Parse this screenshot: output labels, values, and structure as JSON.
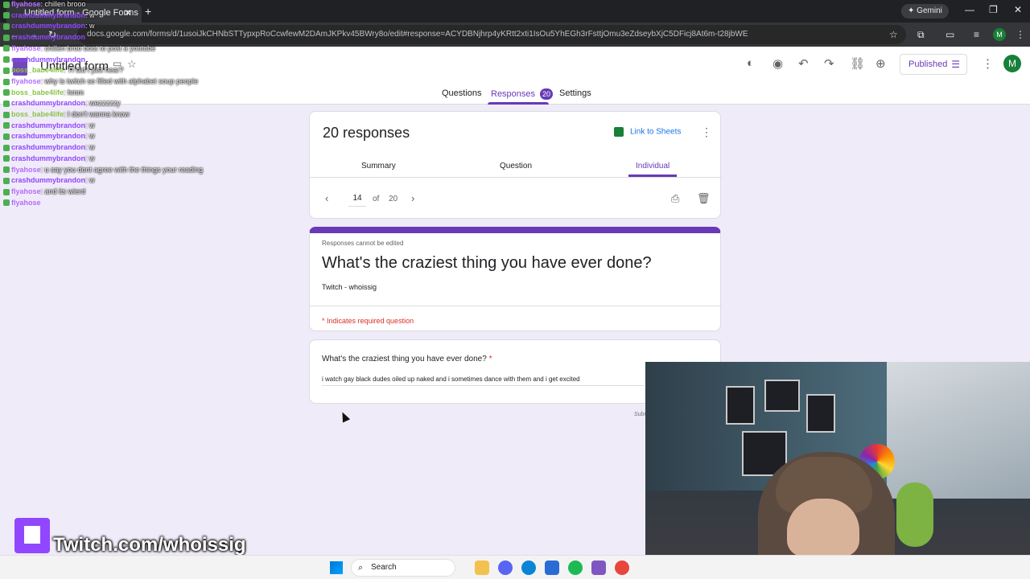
{
  "browser": {
    "tab_title": "Untitled form - Google Forms",
    "url": "docs.google.com/forms/d/1usoiJkCHNbSTTypxpRoCcwfewM2DAmJKPkv45BWry8o/edit#response=ACYDBNjhrp4yKRtt2xti1IsOu5YhEGh3rFsttjOmu3eZdseybXjC5DFicj8At6m-t28jbWE",
    "gemini_label": "Gemini",
    "profile_initial": "M"
  },
  "form_header": {
    "title": "Untitled form",
    "published_label": "Published",
    "avatar_initial": "M",
    "tabs": [
      {
        "label": "Questions"
      },
      {
        "label": "Responses",
        "badge": "20"
      },
      {
        "label": "Settings"
      }
    ]
  },
  "responses_card": {
    "heading": "20 responses",
    "link_to_sheets": "Link to Sheets",
    "subtabs": [
      "Summary",
      "Question",
      "Individual"
    ],
    "pager": {
      "current": "14",
      "of_label": "of",
      "total": "20"
    }
  },
  "response_view": {
    "cannot_edit_note": "Responses cannot be edited",
    "form_title": "What's the craziest thing you have ever done?",
    "form_description": "Twitch - whoissig",
    "required_note": "* Indicates required question",
    "question": "What's the craziest thing you have ever done?",
    "required_star": "*",
    "answer": "i watch gay black dudes oiled up naked and i sometimes dance with them and i get excited",
    "submitted_label": "Subm"
  },
  "chat": [
    {
      "user": "flyahose",
      "color": "#b36bff",
      "msg": "chillen brooo"
    },
    {
      "user": "crashdummybrandon",
      "color": "#9146ff",
      "msg": "w"
    },
    {
      "user": "crashdummybrandon",
      "color": "#9146ff",
      "msg": "w"
    },
    {
      "user": "crashdummybrandon",
      "color": "#9146ff",
      "msg": ""
    },
    {
      "user": "flyahose",
      "color": "#b36bff",
      "msg": "chillen broo bout to post a youtube"
    },
    {
      "user": "crashdummybrandon",
      "color": "#9146ff",
      "msg": ""
    },
    {
      "user": "boss_babe4life",
      "color": "#8bc34a",
      "msg": "Tf did I just hear?"
    },
    {
      "user": "flyahose",
      "color": "#b36bff",
      "msg": "why is twitch so filled with alphabet soup people"
    },
    {
      "user": "boss_babe4life",
      "color": "#8bc34a",
      "msg": "hmm"
    },
    {
      "user": "crashdummybrandon",
      "color": "#9146ff",
      "msg": "wezzzzzy"
    },
    {
      "user": "boss_babe4life",
      "color": "#8bc34a",
      "msg": "I don't wanna know"
    },
    {
      "user": "crashdummybrandon",
      "color": "#9146ff",
      "msg": "w"
    },
    {
      "user": "crashdummybrandon",
      "color": "#9146ff",
      "msg": "w"
    },
    {
      "user": "crashdummybrandon",
      "color": "#9146ff",
      "msg": "w"
    },
    {
      "user": "crashdummybrandon",
      "color": "#9146ff",
      "msg": "w"
    },
    {
      "user": "flyahose",
      "color": "#b36bff",
      "msg": "u say you dont agree with the things your reading"
    },
    {
      "user": "crashdummybrandon",
      "color": "#9146ff",
      "msg": "w"
    },
    {
      "user": "flyahose",
      "color": "#b36bff",
      "msg": "and its wierd"
    },
    {
      "user": "flyahose",
      "color": "#b36bff",
      "msg": ""
    }
  ],
  "overlay": {
    "twitch_text": "Twitch.com/whoissig"
  },
  "taskbar": {
    "search_label": "Search"
  },
  "colors": {
    "accent": "#673ab7",
    "page_bg": "#f0ebf8",
    "required": "#d93025",
    "sheets_green": "#188038"
  }
}
